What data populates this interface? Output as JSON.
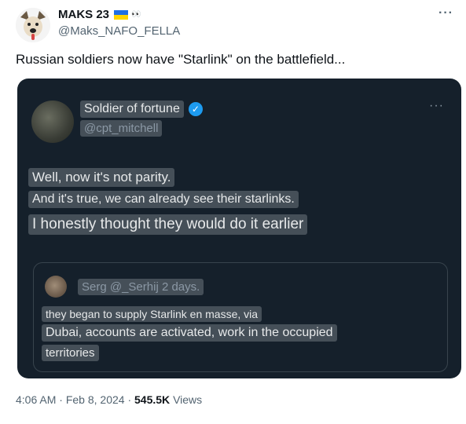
{
  "post": {
    "display_name": "MAKS 23",
    "flag_icon": "ukraine-flag-icon",
    "eyes_emoji": "👀",
    "handle": "@Maks_NAFO_FELLA",
    "more_label": "···",
    "text": "Russian soldiers now have \"Starlink\" on the battlefield..."
  },
  "screenshot": {
    "author_name": "Soldier of fortune",
    "author_handle": "@cpt_mitchell",
    "verified_icon": "verified-badge-icon",
    "more_label": "···",
    "lines": [
      "Well, now it's not parity.",
      "And it's true, we can already see their starlinks.",
      "I honestly thought they would do it earlier"
    ],
    "quote": {
      "header": "Serg @_Serhij 2 days.",
      "lines": [
        "they began to supply Starlink en masse, via",
        "Dubai, accounts are activated, work in the occupied",
        "territories"
      ]
    }
  },
  "meta": {
    "time": "4:06 AM",
    "separator": "·",
    "date": "Feb 8, 2024",
    "views_count": "545.5K",
    "views_label": "Views"
  },
  "colors": {
    "media_bg": "#15202b",
    "verified": "#1d9bf0",
    "secondary_text": "#536471"
  }
}
